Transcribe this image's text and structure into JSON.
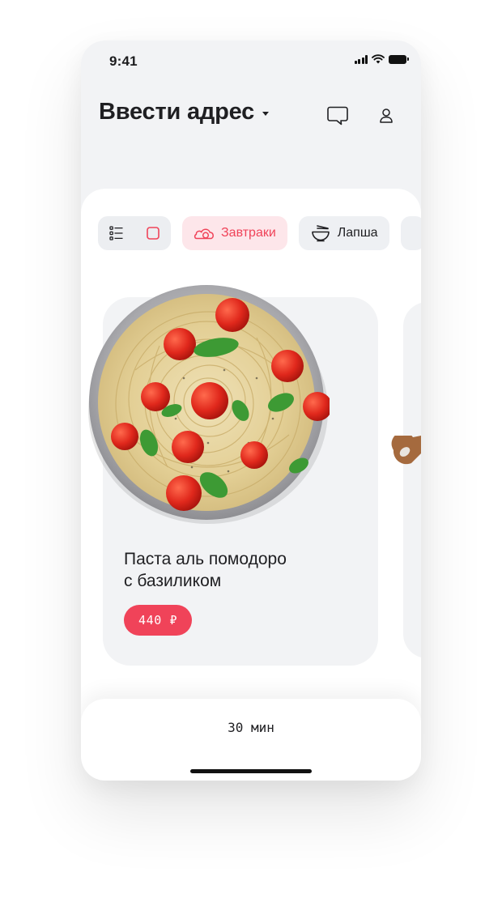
{
  "status_bar": {
    "time": "9:41"
  },
  "header": {
    "address_title": "Ввести адрес"
  },
  "filters": [
    {
      "label": "Завтраки",
      "icon": "breakfast-icon",
      "active": true
    },
    {
      "label": "Лапша",
      "icon": "noodles-bowl-icon",
      "active": false
    }
  ],
  "product": {
    "title_line1": "Паста аль помодоро",
    "title_line2": "с базиликом",
    "price": "440 ₽"
  },
  "bottom_bar": {
    "delivery_time": "30 мин"
  },
  "colors": {
    "accent": "#f04359",
    "accent_soft": "#fde6ea",
    "surface": "#f2f3f5",
    "text": "#1f1f22"
  }
}
